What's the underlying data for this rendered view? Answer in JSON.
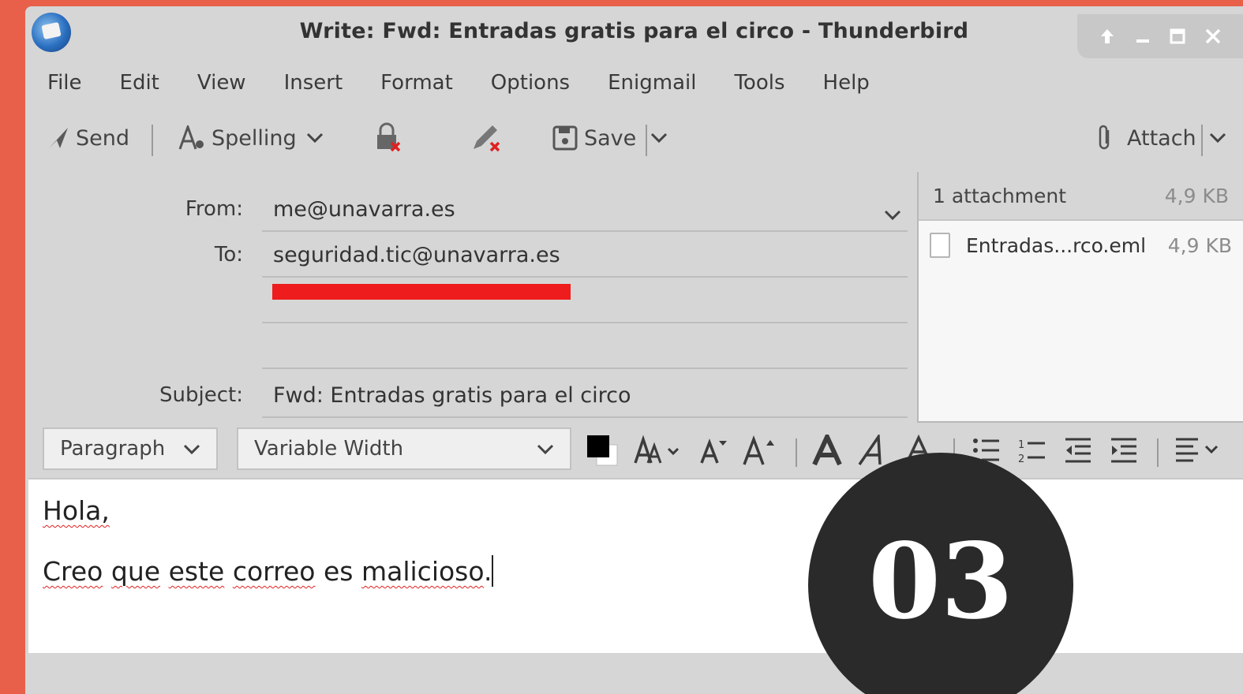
{
  "window": {
    "title": "Write: Fwd: Entradas gratis para el circo - Thunderbird",
    "controls": {
      "up": "⬆",
      "minimize": "‗",
      "maximize": "□",
      "close": "✕"
    }
  },
  "menu": [
    "File",
    "Edit",
    "View",
    "Insert",
    "Format",
    "Options",
    "Enigmail",
    "Tools",
    "Help"
  ],
  "toolbar": {
    "send_label": "Send",
    "spelling_label": "Spelling",
    "save_label": "Save",
    "attach_label": "Attach"
  },
  "header": {
    "from_label": "From:",
    "from_value": "me@unavarra.es",
    "to_label": "To:",
    "to_value": "seguridad.tic@unavarra.es",
    "subject_label": "Subject:",
    "subject_value": "Fwd: Entradas gratis para el circo"
  },
  "attachments": {
    "summary": "1 attachment",
    "total_size": "4,9 KB",
    "items": [
      {
        "name": "Entradas...rco.eml",
        "size": "4,9 KB"
      }
    ]
  },
  "format": {
    "paragraph_style": "Paragraph",
    "font": "Variable Width"
  },
  "body": {
    "line1": "Hola,",
    "line2_words": [
      "Creo",
      "que",
      "este",
      "correo",
      "es",
      "malicioso",
      "."
    ]
  },
  "badge": {
    "text": "03"
  },
  "colors": {
    "background": "#e8604a",
    "window": "#d6d6d6",
    "redaction": "#ee1c1c",
    "badge": "#2a2a2a",
    "spell_error": "#e02020"
  },
  "icons": [
    "send-icon",
    "spelling-icon",
    "encrypt-icon",
    "sign-icon",
    "save-icon",
    "attach-icon"
  ]
}
